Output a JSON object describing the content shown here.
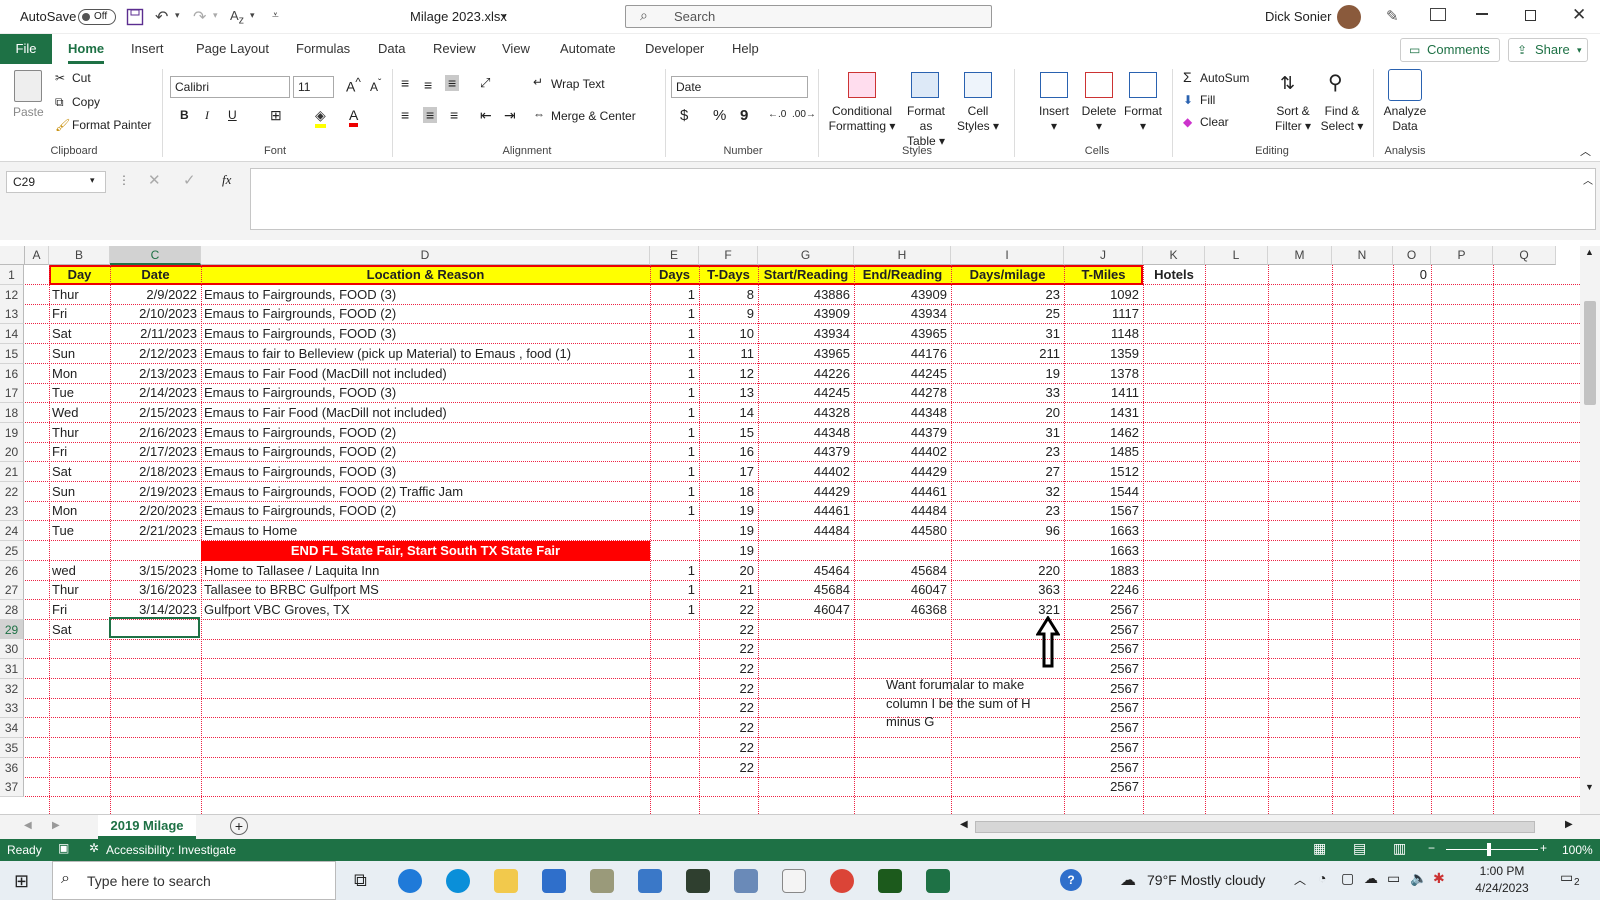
{
  "titlebar": {
    "autosave_label": "AutoSave",
    "autosave_state": "Off",
    "filename": "Milage 2023.xlsx",
    "search_placeholder": "Search",
    "user_name": "Dick Sonier"
  },
  "tabs": [
    "File",
    "Home",
    "Insert",
    "Page Layout",
    "Formulas",
    "Data",
    "Review",
    "View",
    "Automate",
    "Developer",
    "Help"
  ],
  "tab_actions": {
    "comments": "Comments",
    "share": "Share"
  },
  "ribbon": {
    "clipboard": {
      "paste": "Paste",
      "cut": "Cut",
      "copy": "Copy",
      "format_painter": "Format Painter",
      "group": "Clipboard"
    },
    "font": {
      "name": "Calibri",
      "size": "11",
      "bold": "B",
      "italic": "I",
      "underline": "U",
      "group": "Font"
    },
    "alignment": {
      "wrap_text": "Wrap Text",
      "merge_center": "Merge & Center",
      "group": "Alignment"
    },
    "number": {
      "format": "Date",
      "currency": "$",
      "percent": "%",
      "comma": "9",
      "group": "Number"
    },
    "styles": {
      "conditional_1": "Conditional",
      "conditional_2": "Formatting",
      "format_table_1": "Format as",
      "format_table_2": "Table",
      "cell_styles_1": "Cell",
      "cell_styles_2": "Styles",
      "group": "Styles"
    },
    "cells": {
      "insert": "Insert",
      "delete": "Delete",
      "format": "Format",
      "group": "Cells"
    },
    "editing": {
      "autosum": "AutoSum",
      "fill": "Fill",
      "clear": "Clear",
      "sort_1": "Sort &",
      "sort_2": "Filter",
      "find_1": "Find &",
      "find_2": "Select",
      "group": "Editing"
    },
    "analysis": {
      "analyze_1": "Analyze",
      "analyze_2": "Data",
      "group": "Analysis"
    }
  },
  "formula_bar": {
    "name_box": "C29",
    "fx": "fx",
    "value": ""
  },
  "grid": {
    "columns": [
      "A",
      "B",
      "C",
      "D",
      "E",
      "F",
      "G",
      "H",
      "I",
      "J",
      "K",
      "L",
      "M",
      "N",
      "O",
      "P",
      "Q"
    ],
    "selected_column": "C",
    "selected_row": "29",
    "header_row": {
      "row": "1",
      "day": "Day",
      "date": "Date",
      "location": "Location & Reason",
      "days": "Days",
      "t_days": "T-Days",
      "start": "Start/Reading",
      "end": "End/Reading",
      "days_milage": "Days/milage",
      "t_miles": "T-Miles",
      "hotels": "Hotels",
      "o_value": "0"
    },
    "rows": [
      {
        "row": "12",
        "day": "Thur",
        "date": "2/9/2022",
        "location": "Emaus to Fairgrounds,  FOOD (3)",
        "days": "1",
        "t_days": "8",
        "start": "43886",
        "end": "43909",
        "days_milage": "23",
        "t_miles": "1092"
      },
      {
        "row": "13",
        "day": "Fri",
        "date": "2/10/2023",
        "location": "Emaus to Fairgrounds,  FOOD (2)",
        "days": "1",
        "t_days": "9",
        "start": "43909",
        "end": "43934",
        "days_milage": "25",
        "t_miles": "1117"
      },
      {
        "row": "14",
        "day": "Sat",
        "date": "2/11/2023",
        "location": "Emaus to Fairgrounds,  FOOD (3)",
        "days": "1",
        "t_days": "10",
        "start": "43934",
        "end": "43965",
        "days_milage": "31",
        "t_miles": "1148"
      },
      {
        "row": "15",
        "day": "Sun",
        "date": "2/12/2023",
        "location": "Emaus to fair to Belleview (pick up Material) to Emaus , food (1)",
        "days": "1",
        "t_days": "11",
        "start": "43965",
        "end": "44176",
        "days_milage": "211",
        "t_miles": "1359"
      },
      {
        "row": "16",
        "day": "Mon",
        "date": "2/13/2023",
        "location": "Emaus to Fair Food  (MacDill not included)",
        "days": "1",
        "t_days": "12",
        "start": "44226",
        "end": "44245",
        "days_milage": "19",
        "t_miles": "1378"
      },
      {
        "row": "17",
        "day": "Tue",
        "date": "2/14/2023",
        "location": "Emaus to Fairgrounds,  FOOD (3)",
        "days": "1",
        "t_days": "13",
        "start": "44245",
        "end": "44278",
        "days_milage": "33",
        "t_miles": "1411"
      },
      {
        "row": "18",
        "day": "Wed",
        "date": "2/15/2023",
        "location": "Emaus to Fair Food  (MacDill not included)",
        "days": "1",
        "t_days": "14",
        "start": "44328",
        "end": "44348",
        "days_milage": "20",
        "t_miles": "1431"
      },
      {
        "row": "19",
        "day": "Thur",
        "date": "2/16/2023",
        "location": "Emaus to Fairgrounds,  FOOD (2)",
        "days": "1",
        "t_days": "15",
        "start": "44348",
        "end": "44379",
        "days_milage": "31",
        "t_miles": "1462"
      },
      {
        "row": "20",
        "day": "Fri",
        "date": "2/17/2023",
        "location": "Emaus to Fairgrounds,  FOOD (2)",
        "days": "1",
        "t_days": "16",
        "start": "44379",
        "end": "44402",
        "days_milage": "23",
        "t_miles": "1485"
      },
      {
        "row": "21",
        "day": "Sat",
        "date": "2/18/2023",
        "location": "Emaus to Fairgrounds,  FOOD (3)",
        "days": "1",
        "t_days": "17",
        "start": "44402",
        "end": "44429",
        "days_milage": "27",
        "t_miles": "1512"
      },
      {
        "row": "22",
        "day": "Sun",
        "date": "2/19/2023",
        "location": "Emaus to Fairgrounds,  FOOD (2) Traffic Jam",
        "days": "1",
        "t_days": "18",
        "start": "44429",
        "end": "44461",
        "days_milage": "32",
        "t_miles": "1544"
      },
      {
        "row": "23",
        "day": "Mon",
        "date": "2/20/2023",
        "location": "Emaus to Fairgrounds,  FOOD (2)",
        "days": "1",
        "t_days": "19",
        "start": "44461",
        "end": "44484",
        "days_milage": "23",
        "t_miles": "1567"
      },
      {
        "row": "24",
        "day": "Tue",
        "date": "2/21/2023",
        "location": "Emaus  to Home",
        "days": "",
        "t_days": "19",
        "start": "44484",
        "end": "44580",
        "days_milage": "96",
        "t_miles": "1663"
      },
      {
        "row": "25",
        "day": "",
        "date": "",
        "location": "END FL State Fair, Start South TX State Fair",
        "days": "",
        "t_days": "19",
        "start": "",
        "end": "",
        "days_milage": "",
        "t_miles": "1663"
      },
      {
        "row": "26",
        "day": "wed",
        "date": "3/15/2023",
        "location": "Home to Tallasee / Laquita Inn",
        "days": "1",
        "t_days": "20",
        "start": "45464",
        "end": "45684",
        "days_milage": "220",
        "t_miles": "1883"
      },
      {
        "row": "27",
        "day": "Thur",
        "date": "3/16/2023",
        "location": "Tallasee to BRBC Gulfport MS",
        "days": "1",
        "t_days": "21",
        "start": "45684",
        "end": "46047",
        "days_milage": "363",
        "t_miles": "2246"
      },
      {
        "row": "28",
        "day": "Fri",
        "date": "3/14/2023",
        "location": "Gulfport VBC Groves, TX",
        "days": "1",
        "t_days": "22",
        "start": "46047",
        "end": "46368",
        "days_milage": "321",
        "t_miles": "2567"
      },
      {
        "row": "29",
        "day": "Sat",
        "date": "",
        "location": "",
        "days": "",
        "t_days": "22",
        "start": "",
        "end": "",
        "days_milage": "",
        "t_miles": "2567"
      },
      {
        "row": "30",
        "day": "",
        "date": "",
        "location": "",
        "days": "",
        "t_days": "22",
        "start": "",
        "end": "",
        "days_milage": "",
        "t_miles": "2567"
      },
      {
        "row": "31",
        "day": "",
        "date": "",
        "location": "",
        "days": "",
        "t_days": "22",
        "start": "",
        "end": "",
        "days_milage": "",
        "t_miles": "2567"
      },
      {
        "row": "32",
        "day": "",
        "date": "",
        "location": "",
        "days": "",
        "t_days": "22",
        "start": "",
        "end": "",
        "days_milage": "",
        "t_miles": "2567"
      },
      {
        "row": "33",
        "day": "",
        "date": "",
        "location": "",
        "days": "",
        "t_days": "22",
        "start": "",
        "end": "",
        "days_milage": "",
        "t_miles": "2567"
      },
      {
        "row": "34",
        "day": "",
        "date": "",
        "location": "",
        "days": "",
        "t_days": "22",
        "start": "",
        "end": "",
        "days_milage": "",
        "t_miles": "2567"
      },
      {
        "row": "35",
        "day": "",
        "date": "",
        "location": "",
        "days": "",
        "t_days": "22",
        "start": "",
        "end": "",
        "days_milage": "",
        "t_miles": "2567"
      },
      {
        "row": "36",
        "day": "",
        "date": "",
        "location": "",
        "days": "",
        "t_days": "22",
        "start": "",
        "end": "",
        "days_milage": "",
        "t_miles": "2567"
      },
      {
        "row": "37",
        "day": "",
        "date": "",
        "location": "",
        "days": "",
        "t_days": "",
        "start": "",
        "end": "",
        "days_milage": "",
        "t_miles": "2567"
      }
    ],
    "note": "Want forumalar to make column I be the sum of H minus G",
    "red_band_color": "#ff0000",
    "header_fill_color": "#ffff00"
  },
  "sheet_tabs": [
    "2019 Milage"
  ],
  "status_bar": {
    "ready": "Ready",
    "accessibility": "Accessibility: Investigate",
    "zoom": "100%"
  },
  "taskbar": {
    "search_placeholder": "Type here to search",
    "weather": "79°F  Mostly cloudy",
    "time": "1:00 PM",
    "date": "4/24/2023",
    "notifications": "2"
  },
  "colors": {
    "excel_green": "#1e7145",
    "grid_line": "#e22244"
  }
}
